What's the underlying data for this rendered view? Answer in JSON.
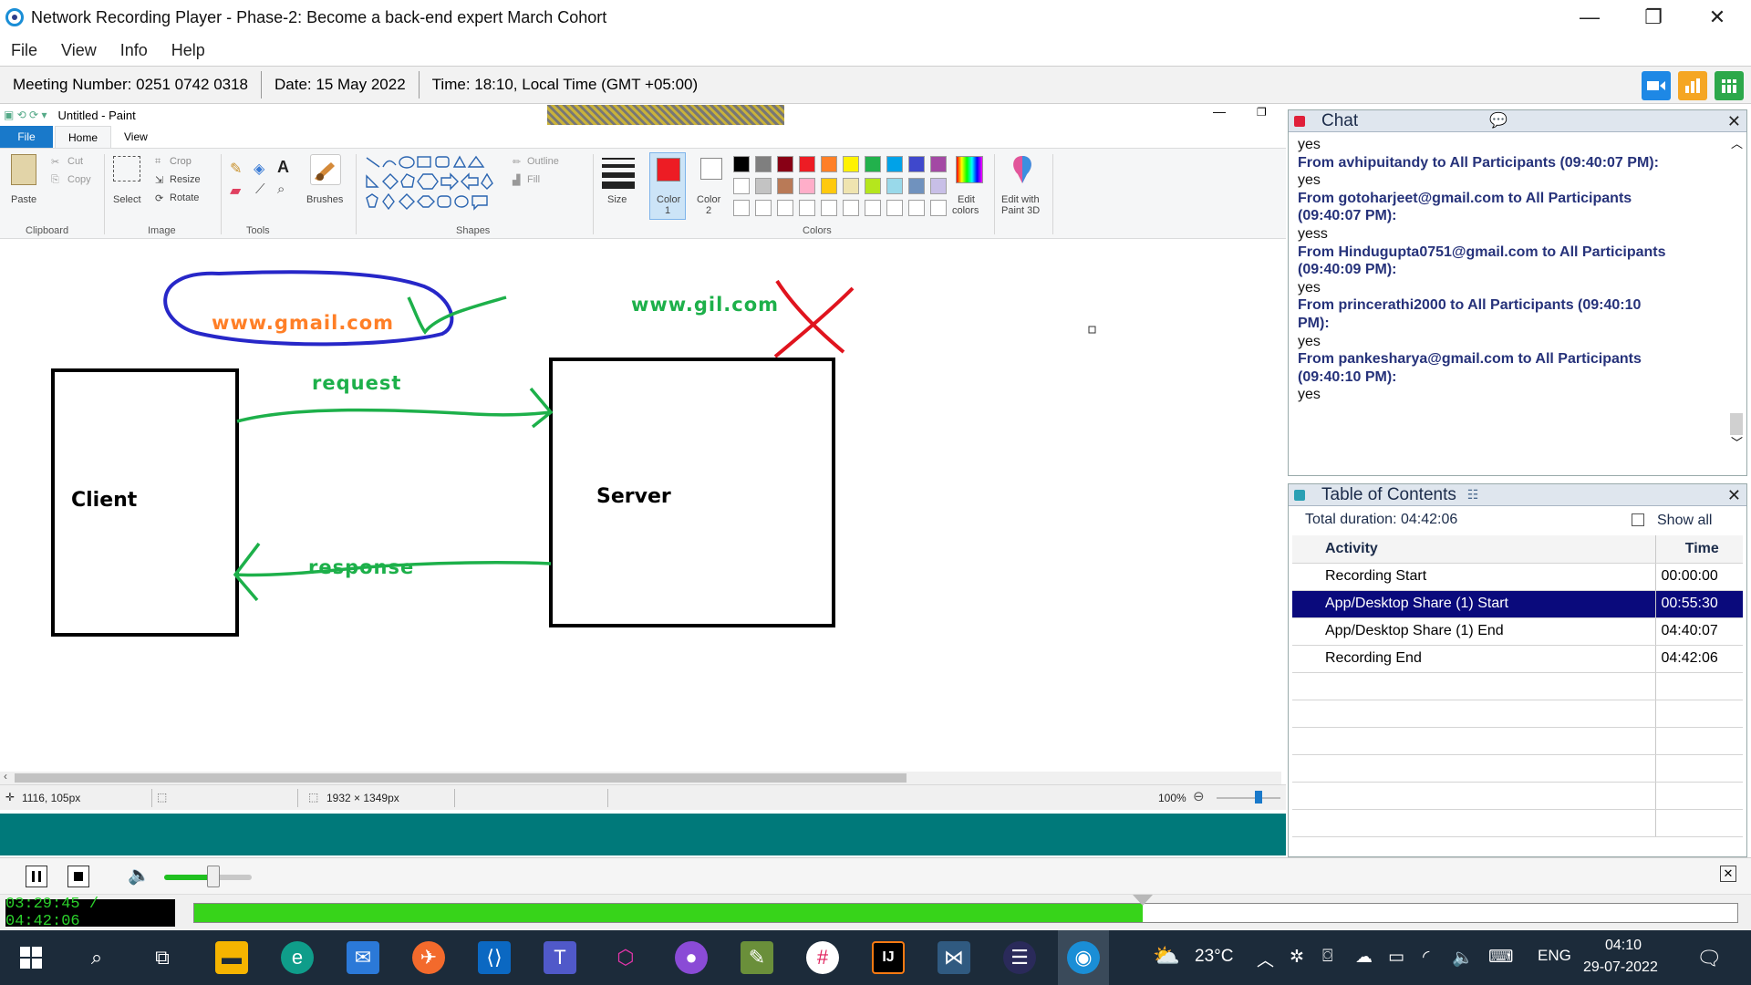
{
  "window": {
    "title": "Network Recording Player - Phase-2: Become a back-end expert March Cohort",
    "minimize": "—",
    "restore": "❐",
    "close": "✕"
  },
  "menu": [
    "File",
    "View",
    "Info",
    "Help"
  ],
  "info": {
    "meeting": "Meeting Number: 0251 0742 0318",
    "date": "Date: 15 May 2022",
    "time": "Time: 18:10, Local Time (GMT +05:00)"
  },
  "toolbar_buttons": [
    {
      "icon": "video-icon",
      "color": "#1e88e5"
    },
    {
      "icon": "chart-icon",
      "color": "#f5a623"
    },
    {
      "icon": "grid-icon",
      "color": "#2ca84a"
    }
  ],
  "paint": {
    "title": "Untitled - Paint",
    "tabs": [
      "File",
      "Home",
      "View"
    ],
    "clipboard": {
      "paste": "Paste",
      "cut": "Cut",
      "copy": "Copy",
      "label": "Clipboard"
    },
    "image": {
      "select": "Select",
      "crop": "Crop",
      "resize": "Resize",
      "rotate": "Rotate",
      "label": "Image"
    },
    "tools_label": "Tools",
    "brushes": "Brushes",
    "shapes": {
      "outline": "Outline",
      "fill": "Fill",
      "label": "Shapes"
    },
    "size": "Size",
    "color1": "Color",
    "color1_num": "1",
    "color2": "Color",
    "color2_num": "2",
    "colors_label": "Colors",
    "edit_colors": "Edit",
    "edit_colors_2": "colors",
    "edit_3d": "Edit with",
    "edit_3d_2": "Paint 3D",
    "palette_row1": [
      "#000000",
      "#7f7f7f",
      "#880015",
      "#ed1c24",
      "#ff7f27",
      "#fff200",
      "#22b14c",
      "#00a2e8",
      "#3f48cc",
      "#a349a4"
    ],
    "palette_row2": [
      "#ffffff",
      "#c3c3c3",
      "#b97a57",
      "#ffaec9",
      "#ffc90e",
      "#efe4b0",
      "#b5e61d",
      "#99d9ea",
      "#7092be",
      "#c8bfe7"
    ],
    "status": {
      "cursor": "1116, 105px",
      "size": "1932 × 1349px",
      "zoom": "100%"
    },
    "drawing": {
      "gmail": "www.gmail.com",
      "gil": "www.gil.com",
      "request": "request",
      "response": "response",
      "client": "Client",
      "server": "Server"
    }
  },
  "chat": {
    "title": "Chat",
    "messages": [
      {
        "type": "msg",
        "text": "yes"
      },
      {
        "type": "from",
        "text": "From avhipuitandy to All Participants (09:40:07 PM):"
      },
      {
        "type": "msg",
        "text": "yes"
      },
      {
        "type": "from",
        "text": "From gotoharjeet@gmail.com to All Participants"
      },
      {
        "type": "from",
        "text": "(09:40:07 PM):"
      },
      {
        "type": "msg",
        "text": "yess"
      },
      {
        "type": "from",
        "text": "From Hindugupta0751@gmail.com to All Participants"
      },
      {
        "type": "from",
        "text": "(09:40:09 PM):"
      },
      {
        "type": "msg",
        "text": "yes"
      },
      {
        "type": "from",
        "text": "From princerathi2000 to All Participants (09:40:10"
      },
      {
        "type": "from",
        "text": "PM):"
      },
      {
        "type": "msg",
        "text": "yes"
      },
      {
        "type": "from",
        "text": "From pankesharya@gmail.com to All Participants"
      },
      {
        "type": "from",
        "text": "(09:40:10 PM):"
      },
      {
        "type": "msg",
        "text": "yes"
      }
    ]
  },
  "toc": {
    "title": "Table of Contents",
    "total": "Total duration: 04:42:06",
    "show_all": "Show all",
    "col_activity": "Activity",
    "col_time": "Time",
    "rows": [
      {
        "activity": "Recording Start",
        "time": "00:00:00"
      },
      {
        "activity": "App/Desktop Share (1) Start",
        "time": "00:55:30"
      },
      {
        "activity": "App/Desktop Share (1) End",
        "time": "04:40:07"
      },
      {
        "activity": "Recording End",
        "time": "04:42:06"
      }
    ],
    "selected_index": 1
  },
  "player": {
    "time": "03:29:45 / 04:42:06",
    "progress": 0.6148,
    "volume": 0.55
  },
  "taskbar": {
    "weather": "23°C",
    "lang": "ENG",
    "clock_time": "04:10",
    "clock_date": "29-07-2022"
  }
}
